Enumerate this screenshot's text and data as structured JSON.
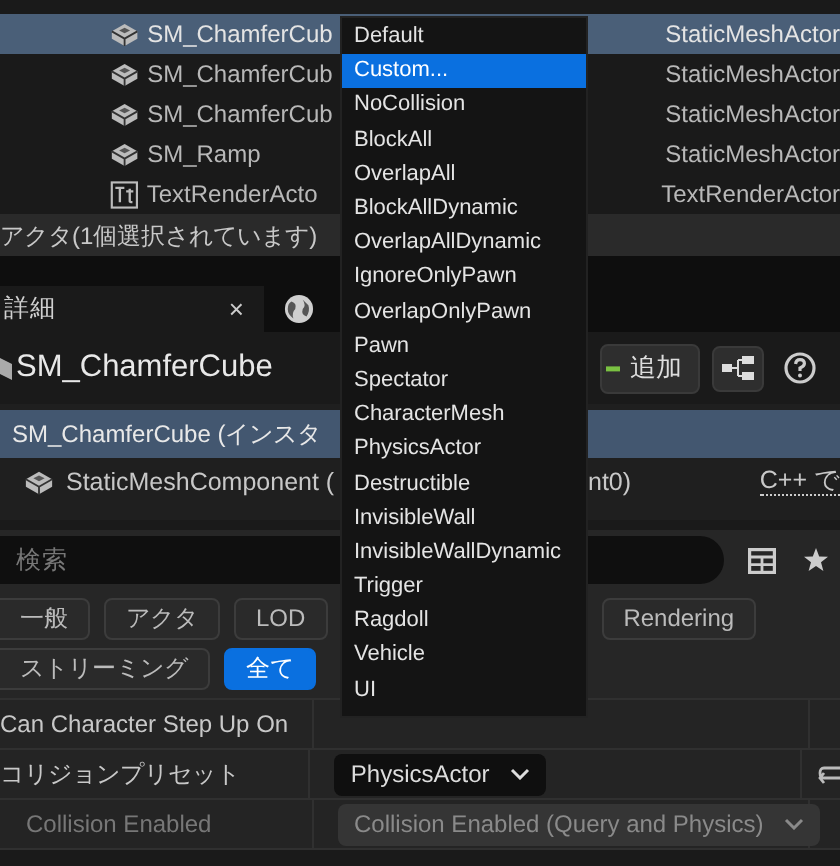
{
  "outliner": {
    "rows": [
      {
        "name": "SM_ChamferCub",
        "type": "StaticMeshActor",
        "kind": "mesh",
        "selected": true
      },
      {
        "name": "SM_ChamferCub",
        "type": "StaticMeshActor",
        "kind": "mesh",
        "selected": false
      },
      {
        "name": "SM_ChamferCub",
        "type": "StaticMeshActor",
        "kind": "mesh",
        "selected": false
      },
      {
        "name": "SM_Ramp",
        "type": "StaticMeshActor",
        "kind": "mesh",
        "selected": false
      },
      {
        "name": "TextRenderActo",
        "type": "TextRenderActor",
        "kind": "text",
        "selected": false
      }
    ],
    "status": "アクタ(1個選択されています)"
  },
  "details": {
    "tab": "詳細",
    "tab_close": "×",
    "title": "SM_ChamferCube",
    "add_button": "追加",
    "components": [
      {
        "label": "SM_ChamferCube (インスタ",
        "selected": true
      },
      {
        "label": "StaticMeshComponent (",
        "tail": "nt0)",
        "link": "C++ で",
        "selected": false
      }
    ],
    "search": {
      "placeholder": "検索"
    },
    "filter_rows": [
      [
        {
          "label": "一般",
          "selected": false
        },
        {
          "label": "アクタ",
          "selected": false
        },
        {
          "label": "LOD",
          "selected": false
        },
        {
          "label": "Rendering",
          "selected": false
        }
      ],
      [
        {
          "label": "ストリーミング",
          "selected": false
        },
        {
          "label": "全て",
          "selected": true
        }
      ]
    ],
    "properties": [
      {
        "label": "Can Character Step Up On",
        "kind": "plain",
        "disabled": false
      },
      {
        "label": "コリジョンプリセット",
        "kind": "combo",
        "value": "PhysicsActor",
        "disabled": false
      },
      {
        "label": "Collision Enabled",
        "kind": "combo",
        "value": "Collision Enabled (Query and Physics)",
        "disabled": true
      }
    ]
  },
  "menu": {
    "items": [
      {
        "label": "Default",
        "selected": false
      },
      {
        "label": "Custom...",
        "selected": true
      },
      {
        "label": "NoCollision",
        "selected": false
      },
      {
        "label": "BlockAll",
        "selected": false
      },
      {
        "label": "OverlapAll",
        "selected": false
      },
      {
        "label": "BlockAllDynamic",
        "selected": false
      },
      {
        "label": "OverlapAllDynamic",
        "selected": false
      },
      {
        "label": "IgnoreOnlyPawn",
        "selected": false
      },
      {
        "label": "OverlapOnlyPawn",
        "selected": false
      },
      {
        "label": "Pawn",
        "selected": false
      },
      {
        "label": "Spectator",
        "selected": false
      },
      {
        "label": "CharacterMesh",
        "selected": false
      },
      {
        "label": "PhysicsActor",
        "selected": false
      },
      {
        "label": "Destructible",
        "selected": false
      },
      {
        "label": "InvisibleWall",
        "selected": false
      },
      {
        "label": "InvisibleWallDynamic",
        "selected": false
      },
      {
        "label": "Trigger",
        "selected": false
      },
      {
        "label": "Ragdoll",
        "selected": false
      },
      {
        "label": "Vehicle",
        "selected": false
      },
      {
        "label": "UI",
        "selected": false
      }
    ]
  }
}
